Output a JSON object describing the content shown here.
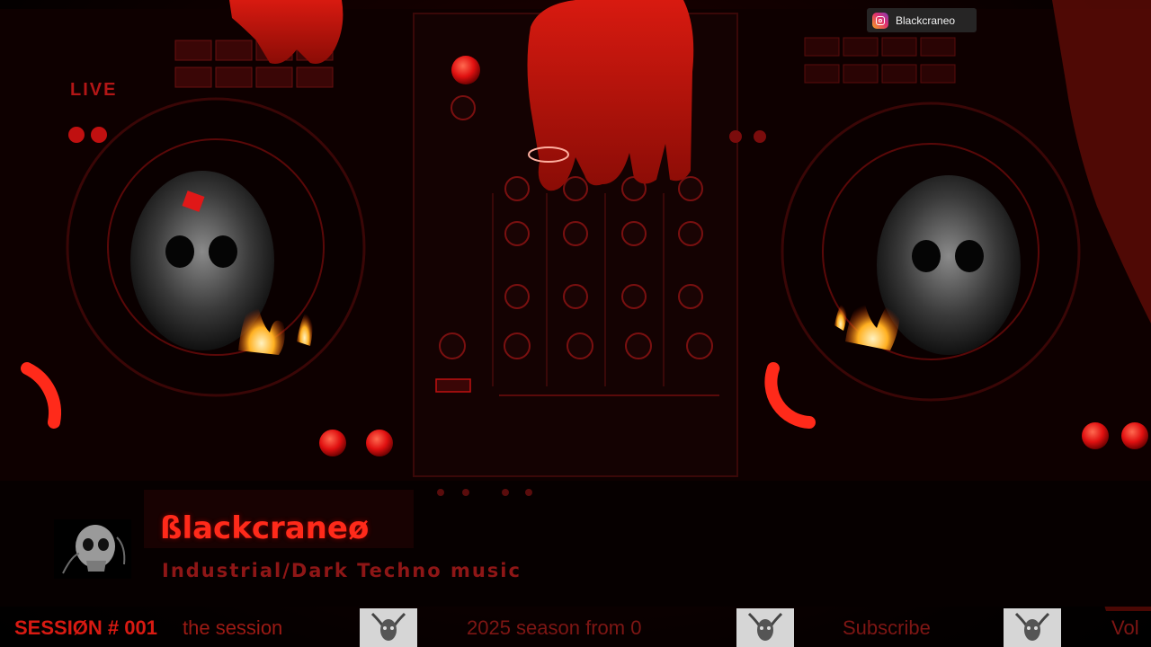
{
  "overlay": {
    "live_label": "LIVE",
    "instagram": {
      "icon": "instagram-icon",
      "handle": "Blackcraneo"
    }
  },
  "lower_third": {
    "title": "ßlackcraneø",
    "subtitle": "Industrial/Dark Techno music",
    "avatar_icon": "skull-avatar"
  },
  "ticker": {
    "session": "SESSIØN # 001",
    "items": [
      "the session",
      "2025 season from 0",
      "Subscribe",
      "Vol"
    ],
    "thumbnail_icon": "goat-skull-thumbnail"
  },
  "colors": {
    "accent_red": "#ff2a1a",
    "dark_red": "#8e1616",
    "badge_bg": "#282828"
  }
}
